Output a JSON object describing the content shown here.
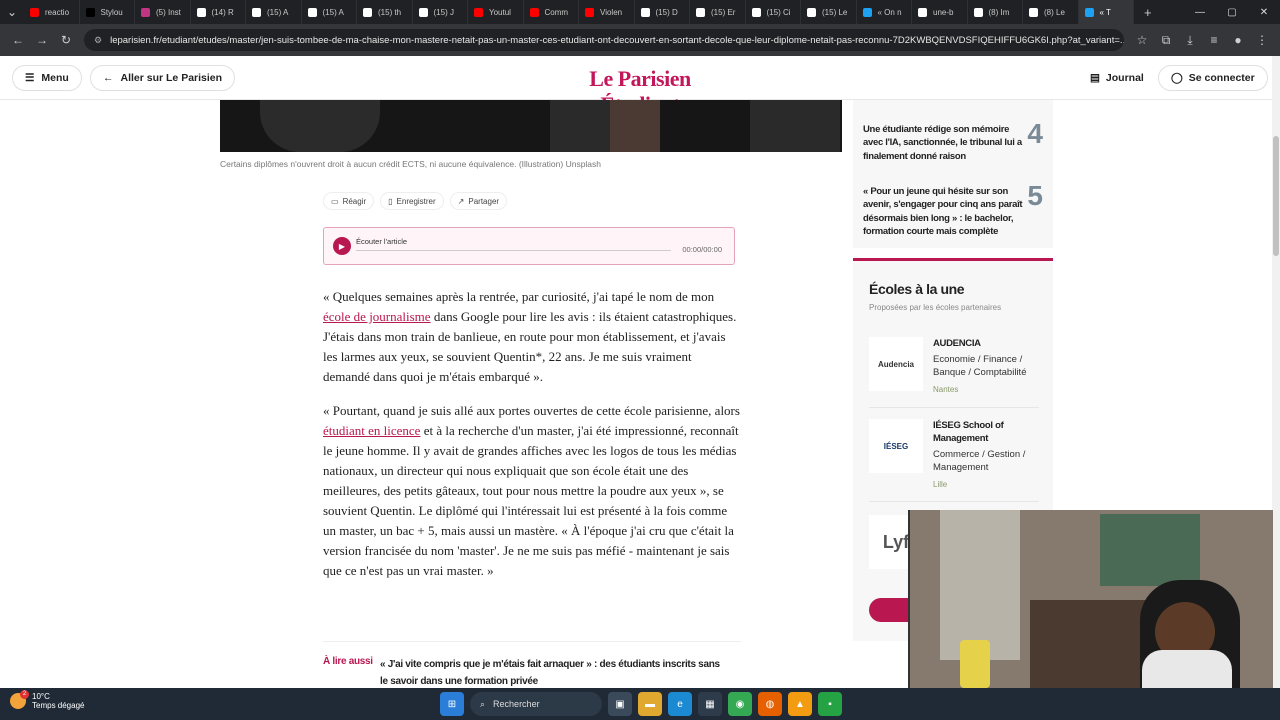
{
  "browser": {
    "tabs": [
      {
        "label": "reactio",
        "color": "#ff0000"
      },
      {
        "label": "Stylou",
        "color": "#000000"
      },
      {
        "label": "(5) Inst",
        "color": "#c13584"
      },
      {
        "label": "(14) R",
        "color": "#ffffff"
      },
      {
        "label": "(15) A",
        "color": "#ffffff"
      },
      {
        "label": "(15) A",
        "color": "#ffffff"
      },
      {
        "label": "(15) th",
        "color": "#ffffff"
      },
      {
        "label": "(15) J",
        "color": "#ffffff"
      },
      {
        "label": "Youtul",
        "color": "#ff0000"
      },
      {
        "label": "Comm",
        "color": "#ff0000"
      },
      {
        "label": "Violen",
        "color": "#ff0000"
      },
      {
        "label": "(15) D",
        "color": "#ffffff"
      },
      {
        "label": "(15) Er",
        "color": "#ffffff"
      },
      {
        "label": "(15) Ci",
        "color": "#ffffff"
      },
      {
        "label": "(15) Le",
        "color": "#ffffff"
      },
      {
        "label": "« On n",
        "color": "#1da1f2"
      },
      {
        "label": "une-b",
        "color": "#ffffff"
      },
      {
        "label": "(8) Im",
        "color": "#ffffff"
      },
      {
        "label": "(8) Le",
        "color": "#ffffff"
      },
      {
        "label": "« T",
        "color": "#1da1f2",
        "active": true
      }
    ],
    "new_tab": "+",
    "url": "leparisien.fr/etudiant/etudes/master/jen-suis-tombee-de-ma-chaise-mon-mastere-netait-pas-un-master-ces-etudiant-ont-decouvert-en-sortant-decole-que-leur-diplome-netait-pas-reconnu-7D2KWBQENVDSFIQEHIFFU6GK6I.php?at_variant=..."
  },
  "header": {
    "menu_label": "Menu",
    "back_label": "Aller sur Le Parisien",
    "logo_part1": "Le Parisien",
    "logo_part2": "Étudiant",
    "journal_label": "Journal",
    "login_label": "Se connecter"
  },
  "article": {
    "caption": "Certains diplômes n'ouvrent droit à aucun crédit ECTS, ni aucune équivalence. (Illustration) Unsplash",
    "actions": {
      "react": "Réagir",
      "save": "Enregistrer",
      "share": "Partager"
    },
    "audio": {
      "label": "Écouter l'article",
      "time": "00:00/00:00"
    },
    "p1_a": "« Quelques semaines après la rentrée, par curiosité, j'ai tapé le nom de mon ",
    "p1_link": "école de journalisme",
    "p1_b": " dans Google pour lire les avis : ils étaient catastrophiques. J'étais dans mon train de banlieue, en route pour mon établissement, et j'avais les larmes aux yeux, se souvient Quentin*, 22 ans. Je me suis vraiment demandé dans quoi je m'étais embarqué ».",
    "p2_a": "« Pourtant, quand je suis allé aux portes ouvertes de cette école parisienne, alors ",
    "p2_link": "étudiant en licence",
    "p2_b": " et à la recherche d'un master, j'ai été impressionné, reconnaît le jeune homme. Il y avait de grandes affiches avec les logos de tous les médias nationaux, un directeur qui nous expliquait que son école était une des meilleures, des petits gâteaux, tout pour nous mettre la poudre aux yeux », se souvient Quentin. Le diplômé qui l'intéressait lui est présenté à la fois comme un master, un bac + 5, mais aussi un mastère. « À l'époque j'ai cru que c'était la version francisée du nom 'master'. Je ne me suis pas méfié - maintenant je sais que ce n'est pas un vrai master. »",
    "read_also_label": "À lire aussi",
    "read_also_text": "« J'ai vite compris que je m'étais fait arnaquer » : des étudiants inscrits sans le savoir dans une formation privée"
  },
  "sidebar": {
    "ranked": [
      {
        "rank": "4",
        "text": "Une étudiante rédige son mémoire avec l'IA, sanctionnée, le tribunal lui a finalement donné raison"
      },
      {
        "rank": "5",
        "text": "« Pour un jeune qui hésite sur son avenir, s'engager pour cinq ans paraît désormais bien long » : le bachelor, formation courte mais complète"
      }
    ],
    "schools_title": "Écoles à la une",
    "schools_sub": "Proposées par les écoles partenaires",
    "schools": [
      {
        "logo": "Audencia",
        "name": "AUDENCIA",
        "category": "Economie / Finance / Banque / Comptabilité",
        "city": "Nantes"
      },
      {
        "logo": "IÉSEG",
        "name": "IÉSEG School of Management",
        "category": "Commerce / Gestion / Management",
        "city": "Lille"
      },
      {
        "logo": "Lyf",
        "name": "",
        "category": "",
        "city": ""
      }
    ]
  },
  "taskbar": {
    "temp": "10°C",
    "weather": "Temps dégagé",
    "badge": "2",
    "search": "Rechercher"
  },
  "colors": {
    "brand": "#c2185b",
    "accent": "#b8174f"
  }
}
